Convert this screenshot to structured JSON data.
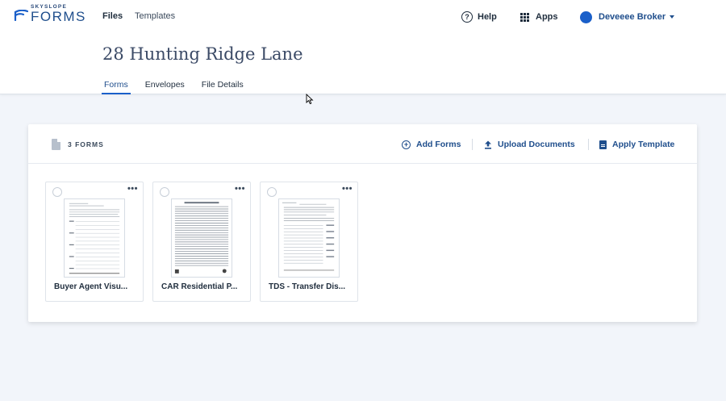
{
  "app": {
    "logo_small": "SKYSLOPE",
    "logo_main": "FORMS"
  },
  "nav": {
    "files": "Files",
    "templates": "Templates"
  },
  "header_right": {
    "help": "Help",
    "apps": "Apps",
    "user": "Deveeee Broker"
  },
  "page": {
    "title": "28 Hunting Ridge Lane"
  },
  "tabs": [
    {
      "label": "Forms",
      "active": true
    },
    {
      "label": "Envelopes",
      "active": false
    },
    {
      "label": "File Details",
      "active": false
    }
  ],
  "forms_panel": {
    "count_label": "3 FORMS",
    "actions": {
      "add": "Add Forms",
      "upload": "Upload Documents",
      "template": "Apply Template"
    },
    "cards": [
      {
        "name": "Buyer Agent Visu...",
        "more": "•••"
      },
      {
        "name": "CAR Residential P...",
        "more": "•••"
      },
      {
        "name": "TDS - Transfer Dis...",
        "more": "•••"
      }
    ]
  },
  "colors": {
    "accent": "#1a5fc9",
    "link": "#1f4e8c",
    "background": "#f2f5fa"
  },
  "icons": {
    "help": "question-circle-icon",
    "apps": "grid-icon",
    "add": "plus-circle-icon",
    "upload": "upload-icon",
    "template": "document-icon",
    "count": "document-icon",
    "more": "ellipsis-icon"
  }
}
